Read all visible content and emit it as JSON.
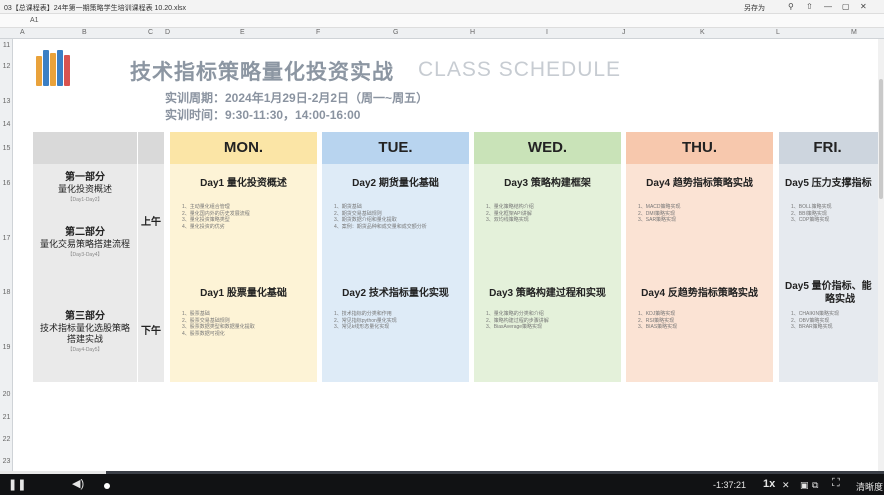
{
  "window": {
    "title": "03【总课程表】24年第一期策略学生培训课程表 10.20.xlsx",
    "save_as": "另存为",
    "controls": [
      "⚲",
      "⇧",
      "—",
      "▢",
      "✕"
    ]
  },
  "formula_bar": {
    "name_box": "A1"
  },
  "columns": [
    "A",
    "B",
    "C",
    "D",
    "E",
    "F",
    "G",
    "H",
    "I",
    "J",
    "K",
    "L",
    "M"
  ],
  "rows": [
    "11",
    "12",
    "13",
    "14",
    "15",
    "16",
    "17",
    "18",
    "19",
    "20",
    "21",
    "22",
    "23"
  ],
  "header": {
    "title": "技术指标策略量化投资实战",
    "subtitle": "CLASS SCHEDULE",
    "period": "实训周期：2024年1月29日-2月2日（周一~周五）",
    "time": "实训时间：9:30-11:30，14:00-16:00"
  },
  "parts": [
    {
      "title": "第一部分",
      "name": "量化投资概述",
      "range": "【Day1-Day2】"
    },
    {
      "title": "第二部分",
      "name": "量化交易策略搭建流程",
      "range": "【Day3-Day4】"
    },
    {
      "title": "第三部分",
      "name": "技术指标量化选股策略搭建实战",
      "range": "【Day4-Day5】"
    }
  ],
  "sessions": {
    "am": "上午",
    "pm": "下午"
  },
  "days": [
    {
      "name": "MON.",
      "color": "#fbe5a6",
      "body": "#fdf3d6",
      "am_title": "Day1 量化投资概述",
      "am_items": [
        "1、主动量化组合管理",
        "2、量化国内外的历史发展流程",
        "3、量化投资策略类型",
        "4、量化投资的优劣"
      ],
      "pm_title": "Day1 股票量化基础",
      "pm_items": [
        "1、股票基础",
        "2、股票交易基础规则",
        "3、股票数据类型和数据量化提取",
        "4、股票数据可视化"
      ]
    },
    {
      "name": "TUE.",
      "color": "#b8d4ef",
      "body": "#deebf7",
      "am_title": "Day2 期货量化基础",
      "am_items": [
        "1、期货基础",
        "2、期货交易基础规则",
        "3、期货数据介绍和量化提取",
        "4、案例：期货品种和成交量和成交额分析"
      ],
      "pm_title": "Day2 技术指标量化实现",
      "pm_items": [
        "1、技术指标的分类和作用",
        "2、常见指标python量化实现",
        "3、常见k线形态量化实现"
      ]
    },
    {
      "name": "WED.",
      "color": "#c9e3b8",
      "body": "#e4f1da",
      "am_title": "Day3 策略构建框架",
      "am_items": [
        "1、量化策略结构介绍",
        "2、量化框架API讲解",
        "3、双均线策略实现"
      ],
      "pm_title": "Day3 策略构建过程和实现",
      "pm_items": [
        "1、量化策略的分类和介绍",
        "2、策略构建过程的步骤讲解",
        "3、BiasAverage策略实现"
      ]
    },
    {
      "name": "THU.",
      "color": "#f7c8ad",
      "body": "#fbe3d4",
      "am_title": "Day4 趋势指标策略实战",
      "am_items": [
        "1、MACD策略实现",
        "2、DMI策略实现",
        "3、SAR策略实现"
      ],
      "pm_title": "Day4 反趋势指标策略实战",
      "pm_items": [
        "1、KDJ策略实现",
        "2、RSI策略实现",
        "3、BIAS策略实现"
      ]
    },
    {
      "name": "FRI.",
      "color": "#cdd5de",
      "body": "#e6eaef",
      "am_title": "Day5 压力支撑指标",
      "am_items": [
        "1、BOLL策略实现",
        "2、BBI策略实现",
        "3、CDP策略实现"
      ],
      "pm_title": "Day5 量价指标、能",
      "pm_title2": "略实战",
      "pm_items": [
        "1、CHAIKIN策略实现",
        "2、OBV策略实现",
        "3、BRAR策略实现"
      ]
    }
  ],
  "player": {
    "time": "-1:37:21",
    "speed": "1x",
    "clarity": "清晰度",
    "progress": 0.12
  }
}
